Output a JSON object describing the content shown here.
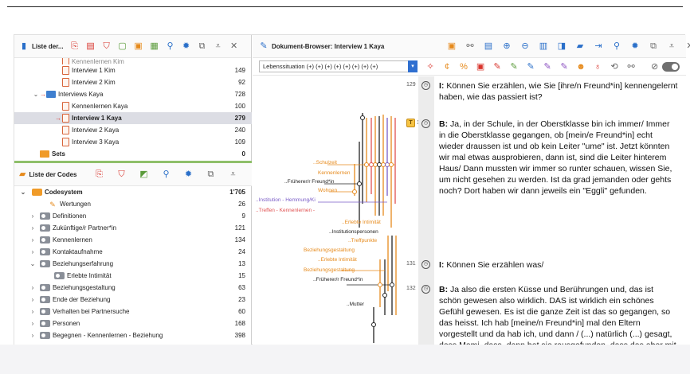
{
  "documents_panel": {
    "title": "Liste der...",
    "rows": [
      {
        "label": "Kennenlernen Kim",
        "count": ""
      },
      {
        "label": "Interview 1 Kim",
        "count": "149"
      },
      {
        "label": "Interview 2 Kim",
        "count": "92"
      },
      {
        "label": "Interviews Kaya",
        "count": "728"
      },
      {
        "label": "Kennenlernen Kaya",
        "count": "100"
      },
      {
        "label": "Interview 1 Kaya",
        "count": "279"
      },
      {
        "label": "Interview 2 Kaya",
        "count": "240"
      },
      {
        "label": "Interview 3 Kaya",
        "count": "109"
      },
      {
        "label": "Sets",
        "count": "0"
      }
    ]
  },
  "codes_panel": {
    "title": "Liste der Codes",
    "rows": [
      {
        "label": "Codesystem",
        "count": "1'705"
      },
      {
        "label": "Wertungen",
        "count": "26"
      },
      {
        "label": "Definitionen",
        "count": "9"
      },
      {
        "label": "Zukünftige/r Partner*in",
        "count": "121"
      },
      {
        "label": "Kennenlernen",
        "count": "134"
      },
      {
        "label": "Kontaktaufnahme",
        "count": "24"
      },
      {
        "label": "Beziehungserfahrung",
        "count": "13"
      },
      {
        "label": "Erlebte Intimität",
        "count": "15"
      },
      {
        "label": "Beziehungsgestaltung",
        "count": "63"
      },
      {
        "label": "Ende der Beziehung",
        "count": "23"
      },
      {
        "label": "Verhalten bei Partnersuche",
        "count": "60"
      },
      {
        "label": "Personen",
        "count": "168"
      },
      {
        "label": "Begegnen - Kennenlernen - Beziehung",
        "count": "398"
      }
    ]
  },
  "document_browser": {
    "title": "Dokument-Browser: Interview 1 Kaya",
    "filter_value": "Lebenssituation (+) (+) (+) (+) (+) (+) (+) (+)",
    "paragraphs": [
      {
        "num": "129",
        "speaker": "I:",
        "text": "Können Sie erzählen, wie Sie [ihre/n Freund*in] kennengelernt haben, wie das passiert ist?"
      },
      {
        "num": "130",
        "speaker": "B:",
        "text": "Ja, in der Schule, in der Oberstklasse bin ich immer/ Immer in die Oberstklasse gegangen, ob [mein/e Freund*in] echt wieder draussen ist und ob kein Leiter \"ume\" ist. Jetzt könnten wir mal etwas ausprobieren, dann ist, sind die Leiter hinterem Haus/ Dann mussten wir immer so runter schauen, wissen Sie, um nicht gesehen zu werden. Ist da grad jemanden oder gehts noch? Dort haben wir dann jeweils ein \"Eggli\" gefunden."
      },
      {
        "num": "131",
        "speaker": "I:",
        "text": "Können Sie erzählen was/"
      },
      {
        "num": "132",
        "speaker": "B:",
        "text": "Ja also die ersten Küsse und Berührungen und, das ist schön gewesen also wirklich. DAS ist wirklich ein schönes Gefühl gewesen. Es ist die ganze Zeit ist das so gegangen, so das heisst. Ich hab [meine/n Freund*in] mal den Eltern vorgestellt und da hab ich, und dann / (...) natürlich (...) gesagt, dass Mami, dass, dann hat sie rausgefunden, dass das aber mit der Zeit nicht mehr so gut gelaufen ist."
      }
    ],
    "memo_label": "T",
    "code_labels": [
      {
        "text": "..Schulzeit",
        "color": "#e68a1c"
      },
      {
        "text": "Kennenlernen",
        "color": "#e68a1c"
      },
      {
        "text": "..Früherer/r Freund*in",
        "color": "#222222"
      },
      {
        "text": "Wohnen",
        "color": "#e68a1c"
      },
      {
        "text": "..Institution - Hemmung/Ki",
        "color": "#7a5cc7"
      },
      {
        "text": "..Treffen - Kennenlernen -",
        "color": "#e05050"
      },
      {
        "text": "..Erlebte Intimität",
        "color": "#e68a1c"
      },
      {
        "text": "..Institutionspersonen",
        "color": "#222222"
      },
      {
        "text": "..Treffpunkte",
        "color": "#e68a1c"
      },
      {
        "text": "Beziehungsgestaltung",
        "color": "#e68a1c"
      },
      {
        "text": "..Erlebte Intimität",
        "color": "#e68a1c"
      },
      {
        "text": "Beziehungsgestaltung",
        "color": "#e68a1c"
      },
      {
        "text": "..Früherer/r Freund*in",
        "color": "#222222"
      },
      {
        "text": "..Mutter",
        "color": "#222222"
      }
    ]
  }
}
